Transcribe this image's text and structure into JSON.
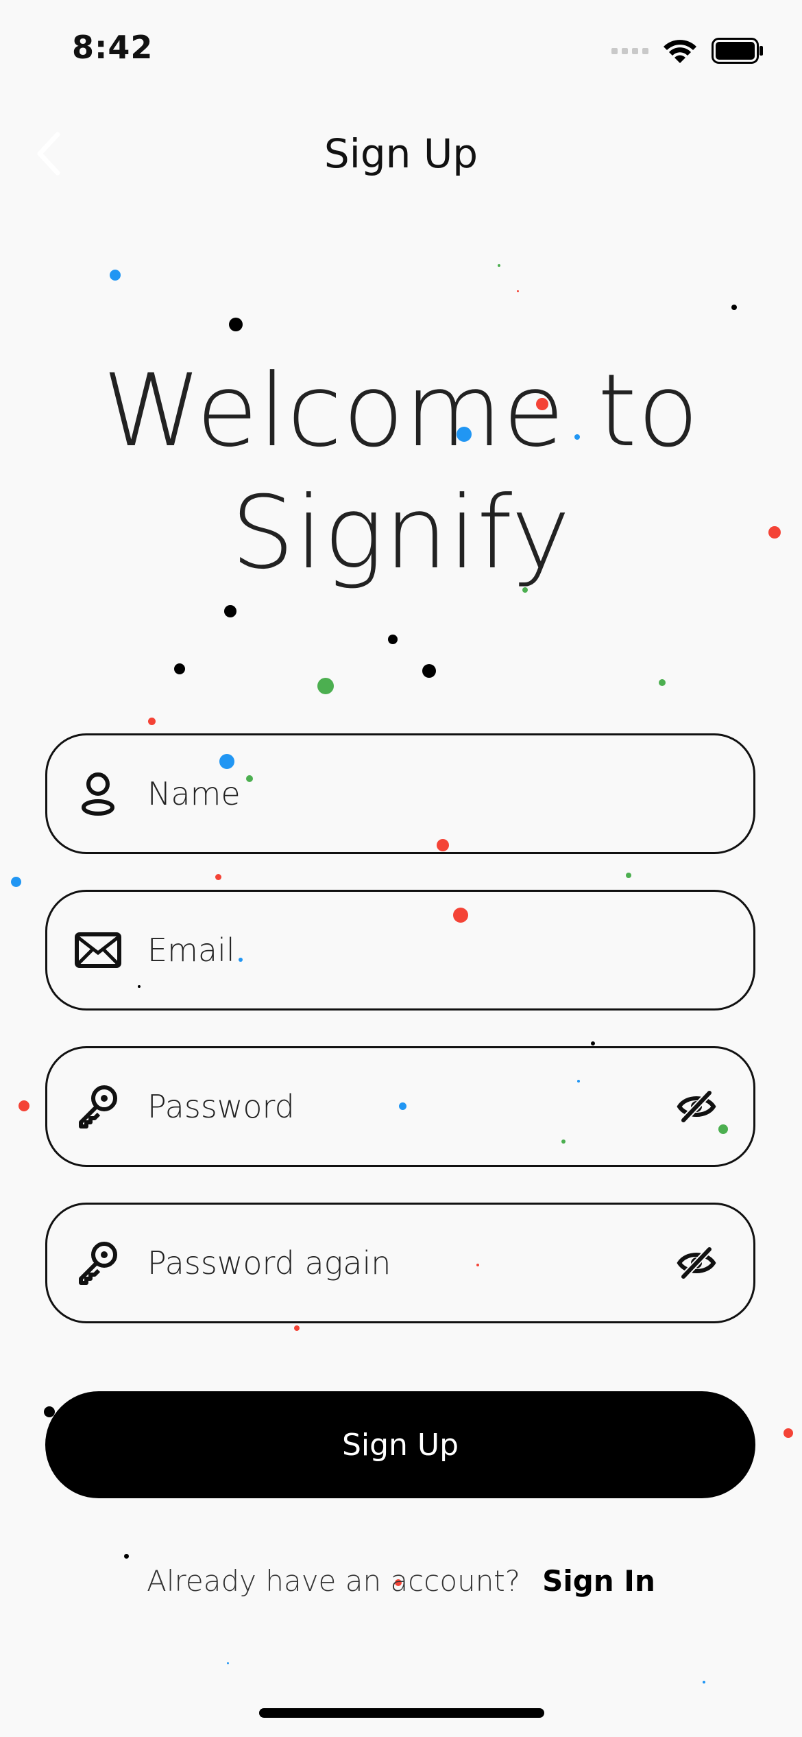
{
  "status_bar": {
    "time": "8:42"
  },
  "nav": {
    "title": "Sign Up"
  },
  "headline": {
    "line1": "Welcome to",
    "line2": "Signify"
  },
  "form": {
    "name_placeholder": "Name",
    "email_placeholder": "Email",
    "password_placeholder": "Password",
    "password_again_placeholder": "Password again"
  },
  "primary_button": {
    "label": "Sign Up"
  },
  "footer": {
    "prompt": "Already have an account?",
    "link": "Sign In"
  },
  "colors": {
    "background": "#f9f9f9",
    "primary": "#000000",
    "confetti_blue": "#2196F3",
    "confetti_red": "#F44336",
    "confetti_green": "#4CAF50",
    "confetti_black": "#000000"
  }
}
